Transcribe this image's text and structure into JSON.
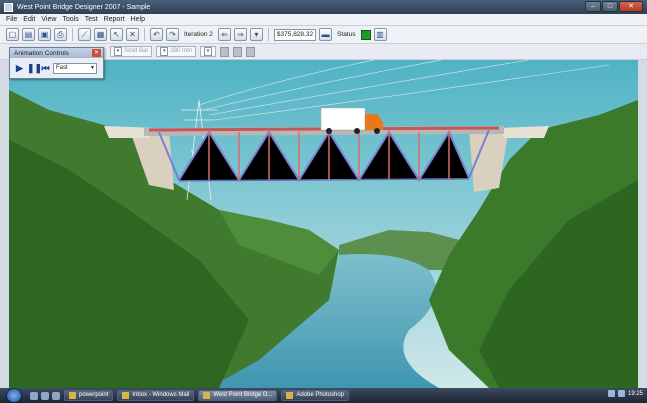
{
  "window": {
    "title": "West Point Bridge Designer 2007 - Sample"
  },
  "menu": [
    "File",
    "Edit",
    "View",
    "Tools",
    "Test",
    "Report",
    "Help"
  ],
  "toolbar": {
    "iteration_label": "Iteration 2",
    "cost": "$375,828.32",
    "status_label": "Status",
    "status_color": "#1f9b2c"
  },
  "toolbar2": {
    "material": "Solid Bar",
    "size": "280 mm"
  },
  "animation": {
    "title": "Animation Controls",
    "speed": "Fast"
  },
  "taskbar": {
    "items": [
      "powerpoint",
      "Inbox - Windows Mail",
      "West Point Bridge D...",
      "Adobe Photoshop"
    ],
    "clock": "19:25"
  }
}
